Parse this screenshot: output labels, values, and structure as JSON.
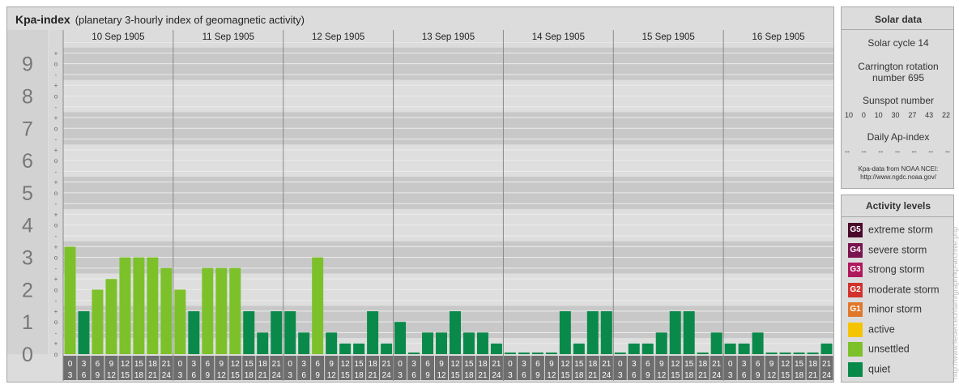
{
  "title": {
    "main": "Kpa-index",
    "subtitle": "(planetary 3-hourly index of geomagnetic activity)"
  },
  "solar": {
    "heading": "Solar data",
    "cycle": "Solar cycle 14",
    "carrington_1": "Carrington rotation",
    "carrington_2": "number 695",
    "sunspot_heading": "Sunspot number",
    "sunspot_values": [
      "10",
      "0",
      "10",
      "30",
      "27",
      "43",
      "22"
    ],
    "ap_heading": "Daily Ap-index",
    "ap_values": [
      "--",
      "--",
      "--",
      "--",
      "--",
      "--",
      "--"
    ],
    "source_1": "Kpa-data from NOAA NCEI:",
    "source_2": "http://www.ngdc.noaa.gov/"
  },
  "activity": {
    "heading": "Activity levels",
    "levels": [
      {
        "badge": "G5",
        "label": "extreme storm",
        "color": "#4a0a2a"
      },
      {
        "badge": "G4",
        "label": "severe storm",
        "color": "#7a1450"
      },
      {
        "badge": "G3",
        "label": "strong storm",
        "color": "#b0185e"
      },
      {
        "badge": "G2",
        "label": "moderate storm",
        "color": "#d2322d"
      },
      {
        "badge": "G1",
        "label": "minor storm",
        "color": "#e0782a"
      },
      {
        "badge": "",
        "label": "active",
        "color": "#f5c400"
      },
      {
        "badge": "",
        "label": "unsettled",
        "color": "#7cc12a"
      },
      {
        "badge": "",
        "label": "quiet",
        "color": "#0a8a4a"
      }
    ]
  },
  "credit": "http://www.lieuen.eu/rlarh/graph/kp-archive.php",
  "chart_data": {
    "type": "bar",
    "y_ticks": [
      "0",
      "1",
      "2",
      "3",
      "4",
      "5",
      "6",
      "7",
      "8",
      "9"
    ],
    "sub_ticks": [
      "o",
      "+",
      "-"
    ],
    "ylim": [
      0,
      9.67
    ],
    "days": [
      "10 Sep 1905",
      "11 Sep 1905",
      "12 Sep 1905",
      "13 Sep 1905",
      "14 Sep 1905",
      "15 Sep 1905",
      "16 Sep 1905"
    ],
    "interval_top": [
      "0",
      "3",
      "6",
      "9",
      "12",
      "15",
      "18",
      "21"
    ],
    "interval_bottom": [
      "3",
      "6",
      "9",
      "12",
      "15",
      "18",
      "21",
      "24"
    ],
    "colors": {
      "quiet": "#0a8a4a",
      "unsettled": "#7cc12a"
    },
    "values": [
      [
        3.33,
        1.33,
        2.0,
        2.33,
        3.0,
        3.0,
        3.0,
        2.67
      ],
      [
        2.0,
        1.33,
        2.67,
        2.67,
        2.67,
        1.33,
        0.67,
        1.33
      ],
      [
        1.33,
        0.67,
        3.0,
        0.67,
        0.33,
        0.33,
        1.33,
        0.33
      ],
      [
        1.0,
        0.0,
        0.67,
        0.67,
        1.33,
        0.67,
        0.67,
        0.33
      ],
      [
        0.0,
        0.0,
        0.0,
        0.0,
        1.33,
        0.33,
        1.33,
        1.33
      ],
      [
        0.0,
        0.33,
        0.33,
        0.67,
        1.33,
        1.33,
        0.0,
        0.67
      ],
      [
        0.33,
        0.33,
        0.67,
        0.0,
        0.0,
        0.0,
        0.0,
        0.33
      ]
    ]
  }
}
